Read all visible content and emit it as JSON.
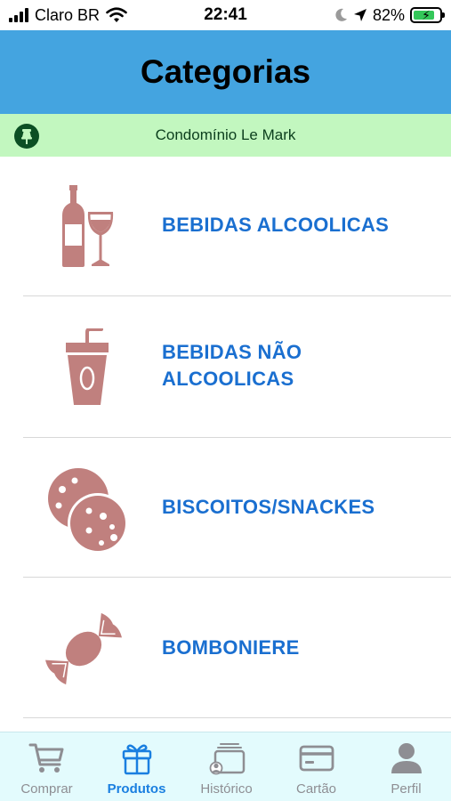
{
  "status_bar": {
    "carrier": "Claro BR",
    "time": "22:41",
    "battery_percent": "82%"
  },
  "header": {
    "title": "Categorias"
  },
  "location": {
    "name": "Condomínio Le Mark"
  },
  "categories": [
    {
      "label_line1": "BEBIDAS ALCOOLICAS",
      "label_line2": "",
      "icon": "wine-bottle-glass-icon"
    },
    {
      "label_line1": "BEBIDAS NÃO",
      "label_line2": "ALCOOLICAS",
      "icon": "soda-cup-icon"
    },
    {
      "label_line1": "BISCOITOS/SNACKES",
      "label_line2": "",
      "icon": "cookies-icon"
    },
    {
      "label_line1": "BOMBONIERE",
      "label_line2": "",
      "icon": "candy-icon"
    }
  ],
  "tab_bar": {
    "tabs": [
      {
        "label": "Comprar",
        "icon": "cart-icon",
        "active": false
      },
      {
        "label": "Produtos",
        "icon": "gift-icon",
        "active": true
      },
      {
        "label": "Histórico",
        "icon": "history-icon",
        "active": false
      },
      {
        "label": "Cartão",
        "icon": "card-icon",
        "active": false
      },
      {
        "label": "Perfil",
        "icon": "profile-icon",
        "active": false
      }
    ]
  },
  "colors": {
    "header_bg": "#44a4e0",
    "banner_bg": "#c2f7bf",
    "icon_color": "#c0807e",
    "label_color": "#1a6fd0",
    "active_tab": "#1a7fe0",
    "inactive_tab": "#8e8e93"
  }
}
